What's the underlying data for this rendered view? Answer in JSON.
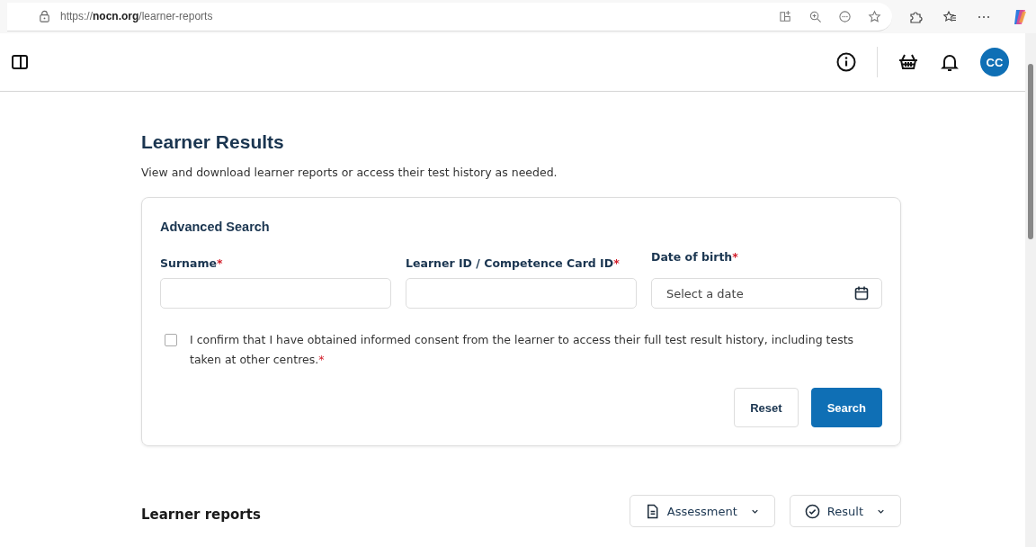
{
  "browser": {
    "url": "https://**nocn.org**/learner-reports"
  },
  "header": {
    "avatar": "CC"
  },
  "page": {
    "title": "Learner Results",
    "subtitle": "View and download learner reports or access their test history as needed."
  },
  "search_card": {
    "title": "Advanced Search",
    "fields": [
      {
        "kind": "text",
        "label": "Surname",
        "required_mark": "*"
      },
      {
        "kind": "text",
        "label": "Learner ID / Competence Card ID",
        "required_mark": "*"
      },
      {
        "kind": "date",
        "label": "Date of birth",
        "required_mark": "*",
        "placeholder": "Select a date"
      }
    ],
    "consent": {
      "checked": false,
      "text": "I confirm that I have obtained informed consent from the learner to access their full test result history, including tests taken at other centres.",
      "required_mark": "*"
    },
    "buttons": [
      {
        "kind": "secondary",
        "label": "Reset"
      },
      {
        "kind": "primary",
        "label": "Search"
      }
    ]
  },
  "reports": {
    "title": "Learner reports",
    "filters": [
      {
        "kind": "document",
        "label": "Assessment"
      },
      {
        "kind": "check",
        "label": "Result"
      }
    ]
  }
}
